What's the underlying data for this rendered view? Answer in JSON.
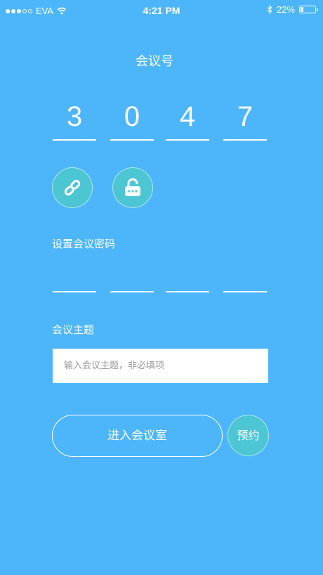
{
  "status_bar": {
    "carrier": "EVA",
    "time": "4:21 PM",
    "battery_percent": "22%",
    "battery_level": 0.22,
    "signal_bars_filled": 3,
    "signal_bars_total": 5
  },
  "meeting": {
    "heading": "会议号",
    "digits": [
      "3",
      "0",
      "4",
      "7"
    ]
  },
  "actions": {
    "link_icon": "link-icon",
    "lock_icon": "unlock-icon"
  },
  "password": {
    "label": "设置会议密码",
    "slots": [
      "",
      "",
      "",
      ""
    ]
  },
  "topic": {
    "label": "会议主题",
    "placeholder": "输入会议主题，非必填项",
    "value": ""
  },
  "buttons": {
    "enter_label": "进入会议室",
    "reserve_label": "预约"
  },
  "colors": {
    "background": "#4db6fb",
    "accent": "#4dc6d4",
    "text": "#ffffff"
  }
}
